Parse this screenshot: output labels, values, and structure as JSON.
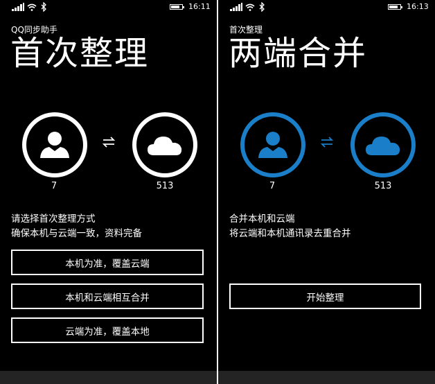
{
  "colors": {
    "accent": "#1a7ec9",
    "background": "#000000",
    "foreground": "#ffffff",
    "appbar": "#242424"
  },
  "left_screen": {
    "status": {
      "time": "16:11",
      "icons": [
        "signal-icon",
        "wifi-icon",
        "bluetooth-icon",
        "battery-icon"
      ]
    },
    "app_title": "QQ同步助手",
    "page_title": "首次整理",
    "local_count": "7",
    "cloud_count": "513",
    "description_line1": "请选择首次整理方式",
    "description_line2": "确保本机与云端一致，资料完备",
    "buttons": [
      "本机为准，覆盖云端",
      "本机和云端相互合并",
      "云端为准，覆盖本地"
    ]
  },
  "right_screen": {
    "status": {
      "time": "16:13",
      "icons": [
        "signal-icon",
        "wifi-icon",
        "bluetooth-icon",
        "battery-icon"
      ]
    },
    "app_title": "首次整理",
    "page_title": "两端合并",
    "local_count": "7",
    "cloud_count": "513",
    "description_line1": "合并本机和云端",
    "description_line2": "将云端和本机通讯录去重合并",
    "start_button": "开始整理"
  }
}
